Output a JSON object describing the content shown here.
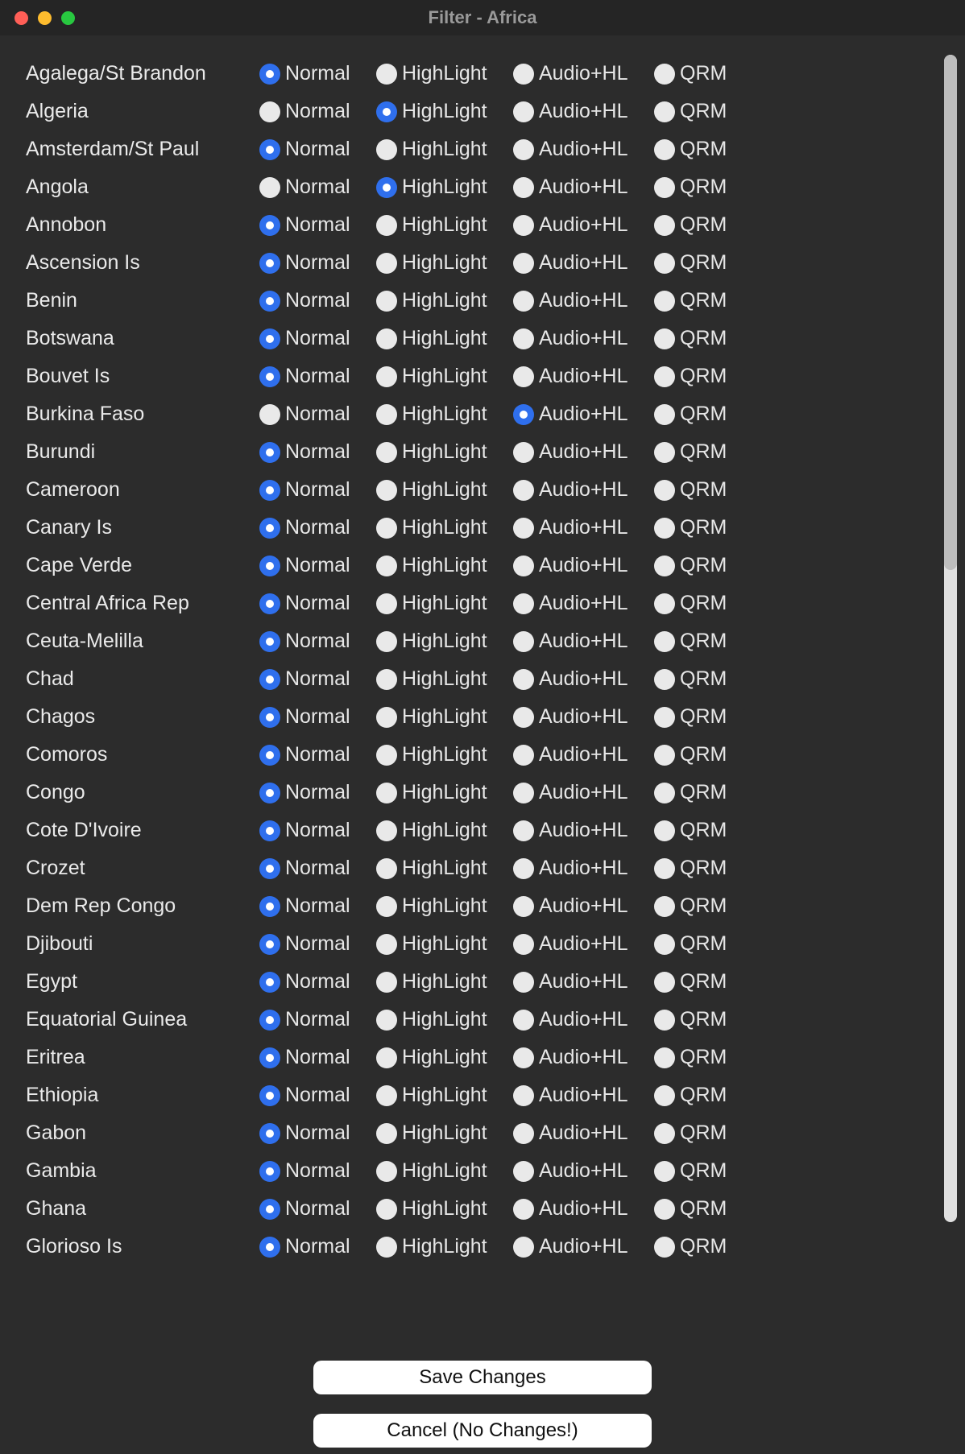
{
  "window": {
    "title": "Filter - Africa"
  },
  "options": {
    "normal": "Normal",
    "highlight": "HighLight",
    "audiohl": "Audio+HL",
    "qrm": "QRM"
  },
  "buttons": {
    "save": "Save Changes",
    "cancel": "Cancel (No Changes!)"
  },
  "rows": [
    {
      "name": "Agalega/St Brandon",
      "selected": "normal"
    },
    {
      "name": "Algeria",
      "selected": "highlight"
    },
    {
      "name": "Amsterdam/St Paul",
      "selected": "normal"
    },
    {
      "name": "Angola",
      "selected": "highlight"
    },
    {
      "name": "Annobon",
      "selected": "normal"
    },
    {
      "name": "Ascension Is",
      "selected": "normal"
    },
    {
      "name": "Benin",
      "selected": "normal"
    },
    {
      "name": "Botswana",
      "selected": "normal"
    },
    {
      "name": "Bouvet Is",
      "selected": "normal"
    },
    {
      "name": "Burkina Faso",
      "selected": "audiohl"
    },
    {
      "name": "Burundi",
      "selected": "normal"
    },
    {
      "name": "Cameroon",
      "selected": "normal"
    },
    {
      "name": "Canary Is",
      "selected": "normal"
    },
    {
      "name": "Cape Verde",
      "selected": "normal"
    },
    {
      "name": "Central Africa Rep",
      "selected": "normal"
    },
    {
      "name": "Ceuta-Melilla",
      "selected": "normal"
    },
    {
      "name": "Chad",
      "selected": "normal"
    },
    {
      "name": "Chagos",
      "selected": "normal"
    },
    {
      "name": "Comoros",
      "selected": "normal"
    },
    {
      "name": "Congo",
      "selected": "normal"
    },
    {
      "name": "Cote D'Ivoire",
      "selected": "normal"
    },
    {
      "name": "Crozet",
      "selected": "normal"
    },
    {
      "name": "Dem Rep Congo",
      "selected": "normal"
    },
    {
      "name": "Djibouti",
      "selected": "normal"
    },
    {
      "name": "Egypt",
      "selected": "normal"
    },
    {
      "name": "Equatorial Guinea",
      "selected": "normal"
    },
    {
      "name": "Eritrea",
      "selected": "normal"
    },
    {
      "name": "Ethiopia",
      "selected": "normal"
    },
    {
      "name": "Gabon",
      "selected": "normal"
    },
    {
      "name": "Gambia",
      "selected": "normal"
    },
    {
      "name": "Ghana",
      "selected": "normal"
    },
    {
      "name": "Glorioso Is",
      "selected": "normal"
    }
  ]
}
